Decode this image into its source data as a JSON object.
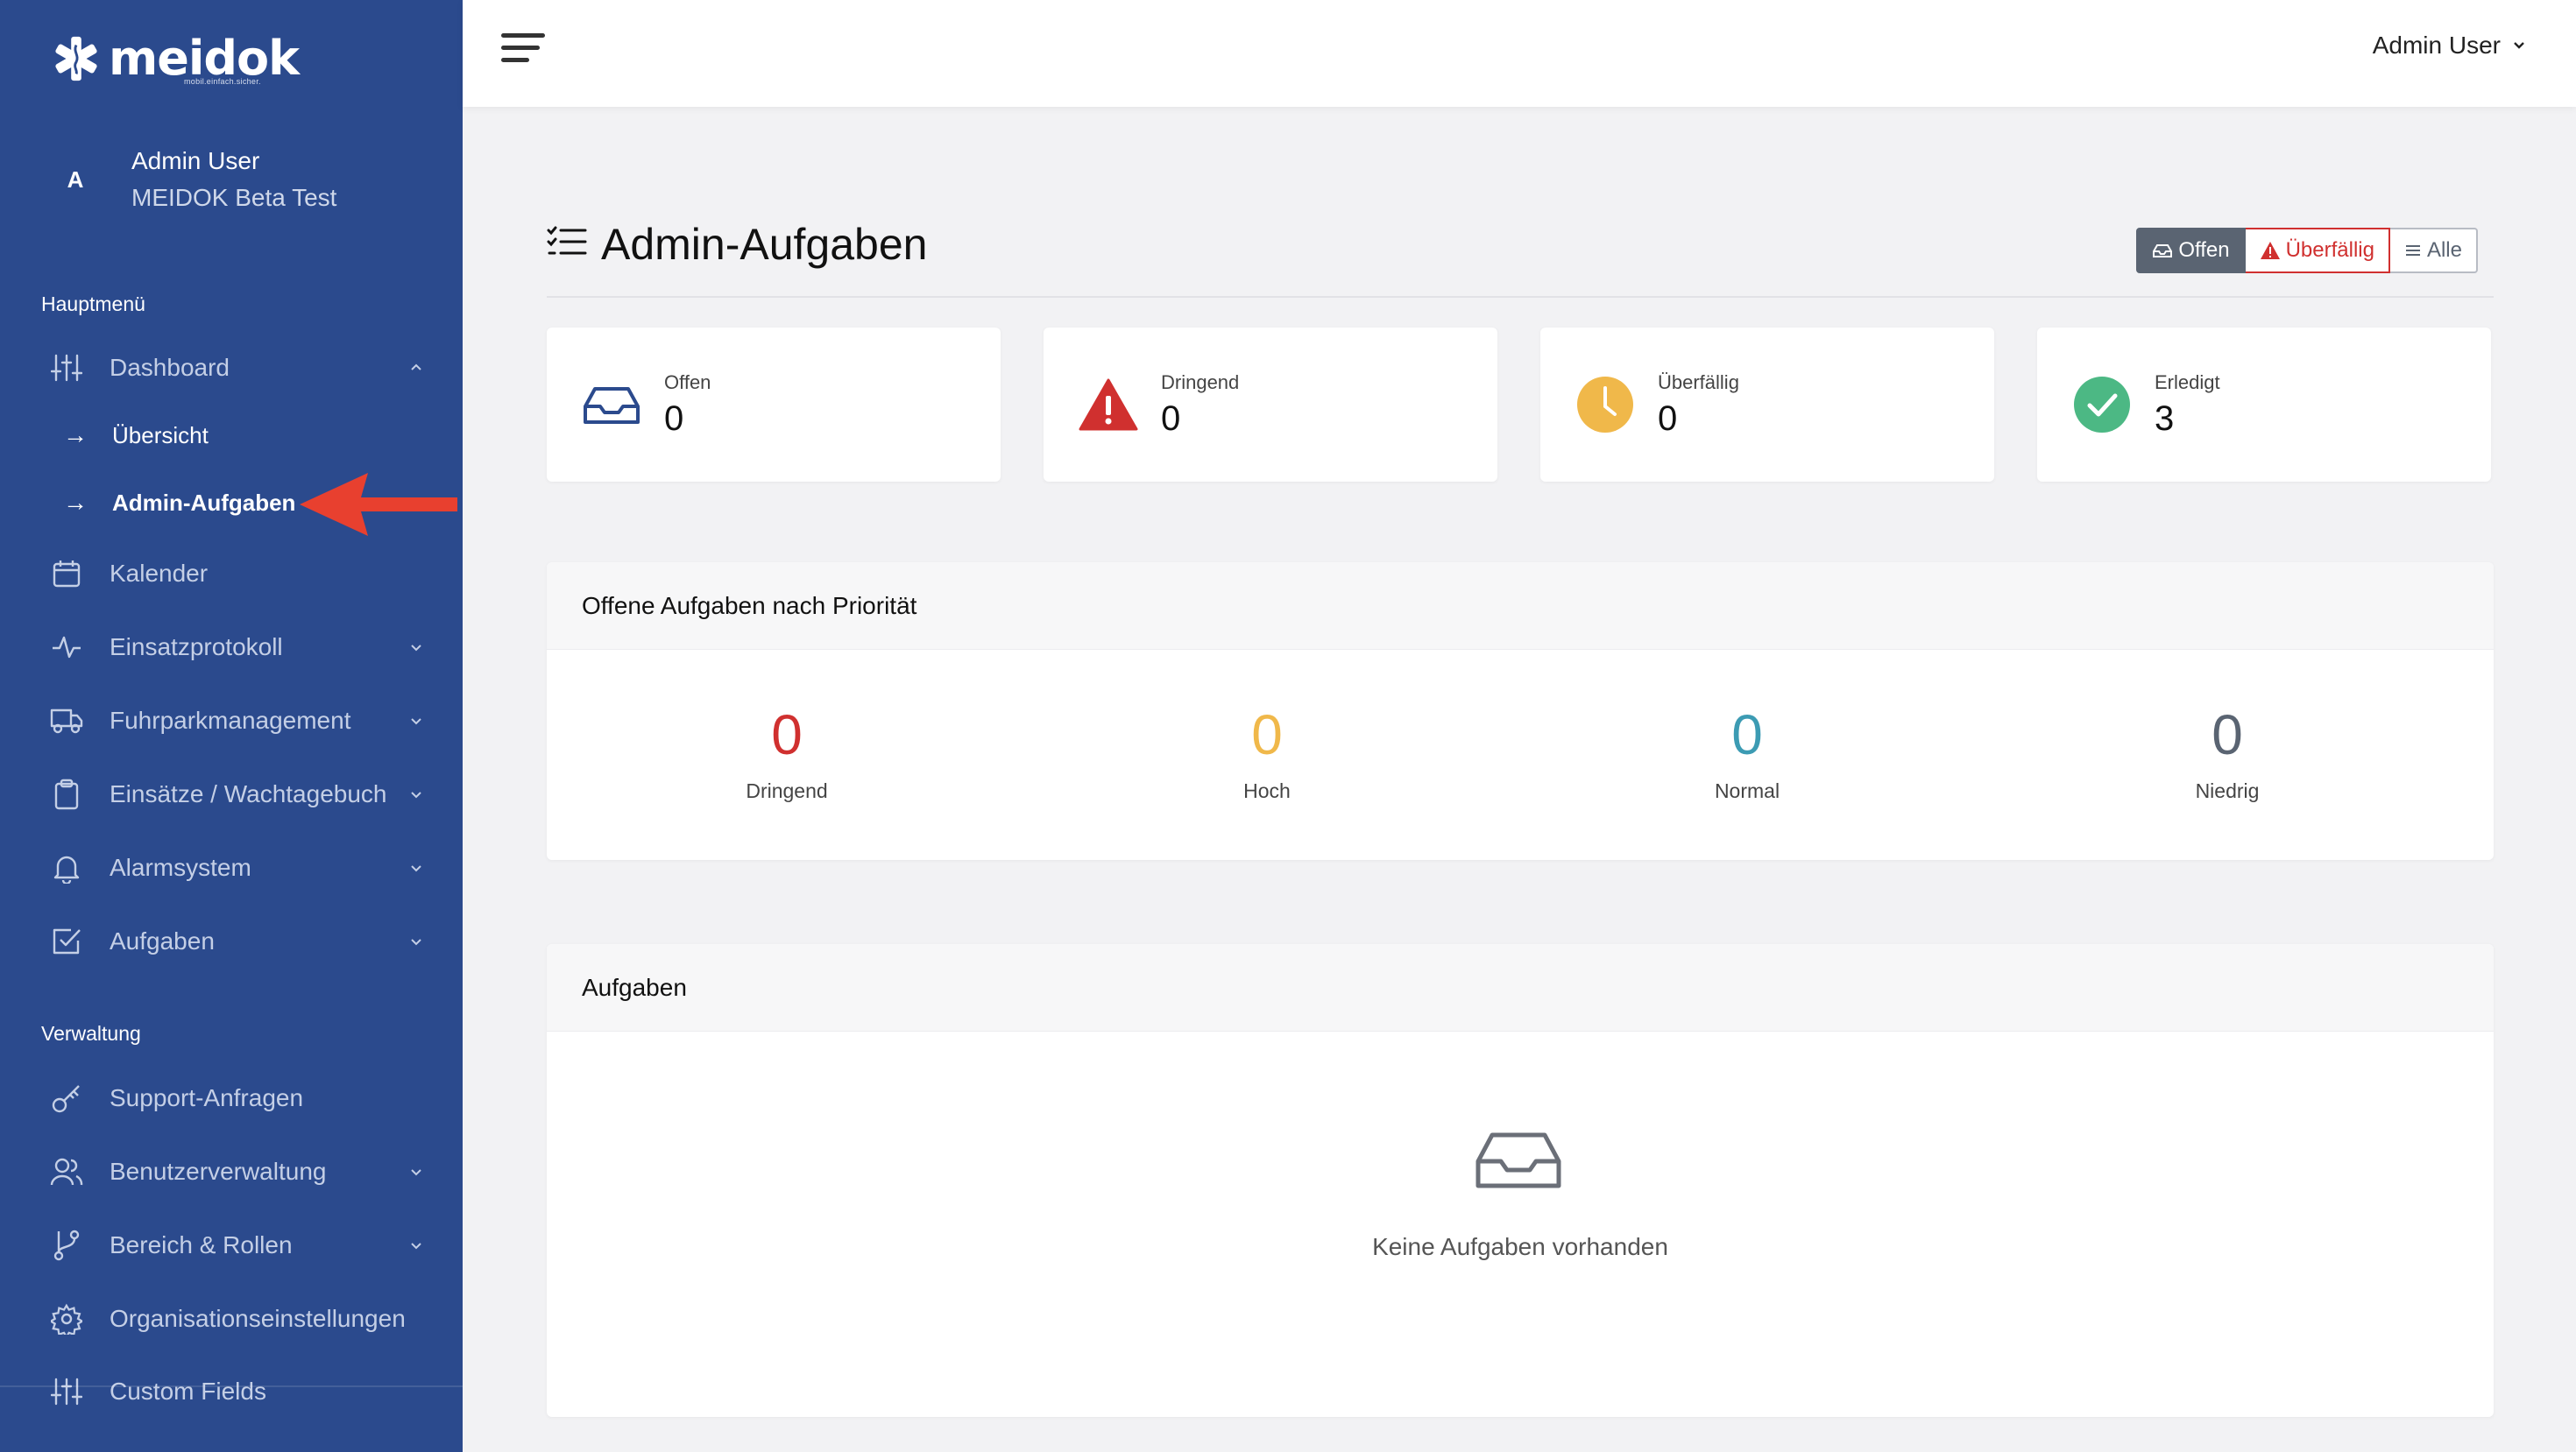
{
  "brand": {
    "name": "meidok",
    "tagline": "mobil.einfach.sicher."
  },
  "colors": {
    "sidebar_bg": "#2b4a8d",
    "danger": "#d0302f",
    "warning": "#f0b84a",
    "info": "#3c9bb3",
    "success": "#4cb884",
    "neutral": "#5a6472"
  },
  "user": {
    "initial": "A",
    "name": "Admin User",
    "organization": "MEIDOK Beta Test"
  },
  "sidebar": {
    "main_section": "Hauptmenü",
    "admin_section": "Verwaltung",
    "items": [
      {
        "label": "Dashboard",
        "icon": "sliders-icon",
        "expandable": true,
        "expanded": true
      },
      {
        "label": "Kalender",
        "icon": "calendar-icon",
        "expandable": false
      },
      {
        "label": "Einsatzprotokoll",
        "icon": "activity-icon",
        "expandable": true
      },
      {
        "label": "Fuhrparkmanagement",
        "icon": "truck-icon",
        "expandable": true
      },
      {
        "label": "Einsätze / Wachtagebuch",
        "icon": "clipboard-icon",
        "expandable": true
      },
      {
        "label": "Alarmsystem",
        "icon": "bell-icon",
        "expandable": true
      },
      {
        "label": "Aufgaben",
        "icon": "check-square-icon",
        "expandable": true
      }
    ],
    "dashboard_sub": [
      {
        "label": "Übersicht",
        "active": false
      },
      {
        "label": "Admin-Aufgaben",
        "active": true
      }
    ],
    "admin_items": [
      {
        "label": "Support-Anfragen",
        "icon": "key-icon",
        "expandable": false
      },
      {
        "label": "Benutzerverwaltung",
        "icon": "users-icon",
        "expandable": true
      },
      {
        "label": "Bereich & Rollen",
        "icon": "git-branch-icon",
        "expandable": true
      },
      {
        "label": "Organisationseinstellungen",
        "icon": "gear-icon",
        "expandable": false
      },
      {
        "label": "Custom Fields",
        "icon": "sliders-icon",
        "expandable": false
      }
    ]
  },
  "topbar": {
    "user_menu_label": "Admin User"
  },
  "page": {
    "title": "Admin-Aufgaben",
    "filters": [
      {
        "label": "Offen",
        "icon": "inbox-icon",
        "active": true
      },
      {
        "label": "Überfällig",
        "icon": "warning-icon",
        "active": false
      },
      {
        "label": "Alle",
        "icon": "list-icon",
        "active": false
      }
    ]
  },
  "stats": [
    {
      "label": "Offen",
      "value": "0",
      "icon": "inbox-icon"
    },
    {
      "label": "Dringend",
      "value": "0",
      "icon": "warning-icon"
    },
    {
      "label": "Überfällig",
      "value": "0",
      "icon": "clock-icon"
    },
    {
      "label": "Erledigt",
      "value": "3",
      "icon": "check-circle-icon"
    }
  ],
  "priority_panel": {
    "title": "Offene Aufgaben nach Priorität",
    "items": [
      {
        "label": "Dringend",
        "value": "0",
        "color": "#d0302f"
      },
      {
        "label": "Hoch",
        "value": "0",
        "color": "#f0b84a"
      },
      {
        "label": "Normal",
        "value": "0",
        "color": "#3c9bb3"
      },
      {
        "label": "Niedrig",
        "value": "0",
        "color": "#5a6472"
      }
    ]
  },
  "tasks_panel": {
    "title": "Aufgaben",
    "empty_text": "Keine Aufgaben vorhanden"
  }
}
